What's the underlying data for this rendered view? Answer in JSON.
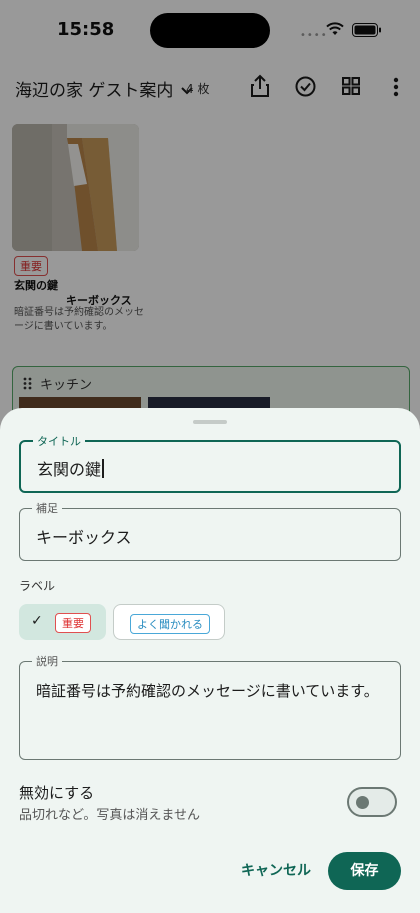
{
  "status": {
    "time": "15:58"
  },
  "appbar": {
    "title": "海辺の家 ゲスト案内",
    "count": "4 枚"
  },
  "card": {
    "badge": "重要",
    "title": "玄関の鍵",
    "subtitle": "キーボックス",
    "description": "暗証番号は予約確認のメッセージに書いています。"
  },
  "section": {
    "label": "キッチン"
  },
  "sheet": {
    "title_field": {
      "label": "タイトル",
      "value": "玄関の鍵"
    },
    "note_field": {
      "label": "補足",
      "value": "キーボックス"
    },
    "labels": {
      "heading": "ラベル",
      "chips": [
        {
          "text": "重要",
          "selected": true
        },
        {
          "text": "よく聞かれる",
          "selected": false
        }
      ]
    },
    "description_field": {
      "label": "説明",
      "value": "暗証番号は予約確認のメッセージに書いています。"
    },
    "disable": {
      "title": "無効にする",
      "subtitle": "品切れなど。写真は消えません",
      "on": false
    },
    "actions": {
      "cancel": "キャンセル",
      "save": "保存"
    }
  },
  "colors": {
    "accent": "#0f6655",
    "important": "#d33333",
    "faq": "#2a8dc0"
  }
}
